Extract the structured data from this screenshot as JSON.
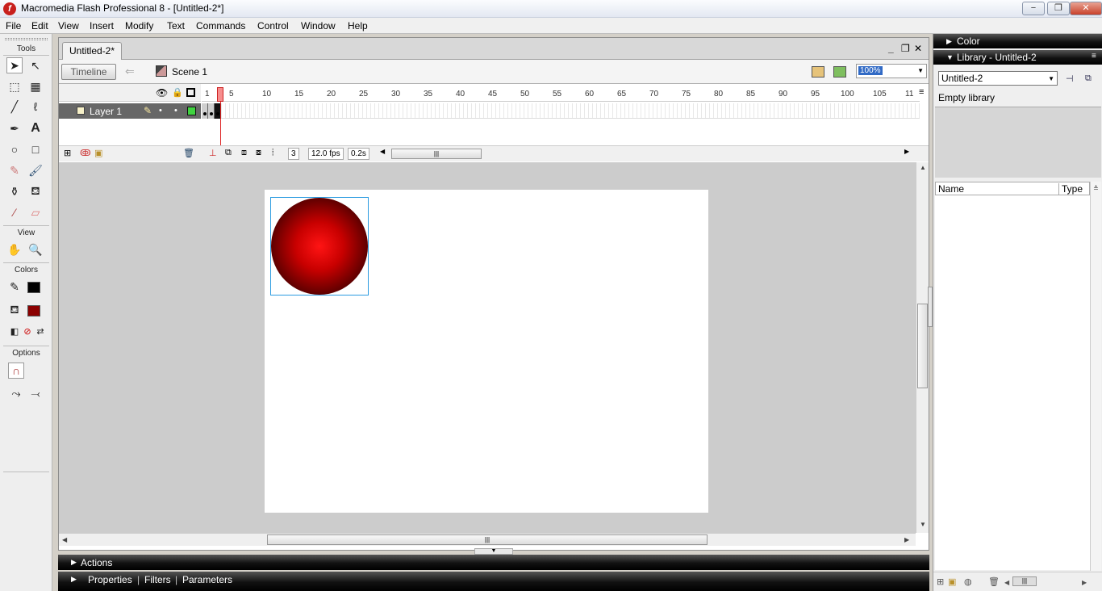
{
  "window": {
    "title": "Macromedia Flash Professional 8 - [Untitled-2*]",
    "minimize": "−",
    "restore": "❐",
    "close": "✕"
  },
  "menu": [
    "File",
    "Edit",
    "View",
    "Insert",
    "Modify",
    "Text",
    "Commands",
    "Control",
    "Window",
    "Help"
  ],
  "tools": {
    "tools_label": "Tools",
    "view_label": "View",
    "colors_label": "Colors",
    "options_label": "Options",
    "stroke_color": "#000000",
    "fill_color": "#8b0000"
  },
  "document": {
    "tab_label": "Untitled-2*",
    "timeline_button": "Timeline",
    "scene_label": "Scene 1",
    "zoom": "100%"
  },
  "timeline": {
    "layer_name": "Layer 1",
    "frame_numbers": [
      "1",
      "5",
      "10",
      "15",
      "20",
      "25",
      "30",
      "35",
      "40",
      "45",
      "50",
      "55",
      "60",
      "65",
      "70",
      "75",
      "80",
      "85",
      "90",
      "95",
      "100",
      "105",
      "11"
    ],
    "current_frame": "3",
    "frame_rate": "12.0 fps",
    "elapsed_time": "0.2s"
  },
  "panels": {
    "actions": "Actions",
    "properties": "Properties",
    "filters": "Filters",
    "parameters": "Parameters",
    "sep": "|"
  },
  "right": {
    "color_panel": "Color",
    "library_panel": "Library - Untitled-2",
    "library_document": "Untitled-2",
    "empty_text": "Empty library",
    "col_name": "Name",
    "col_type": "Type"
  },
  "stage": {
    "circle_gradient": [
      "#ff1414",
      "#c80000",
      "#600000",
      "#000000"
    ]
  }
}
